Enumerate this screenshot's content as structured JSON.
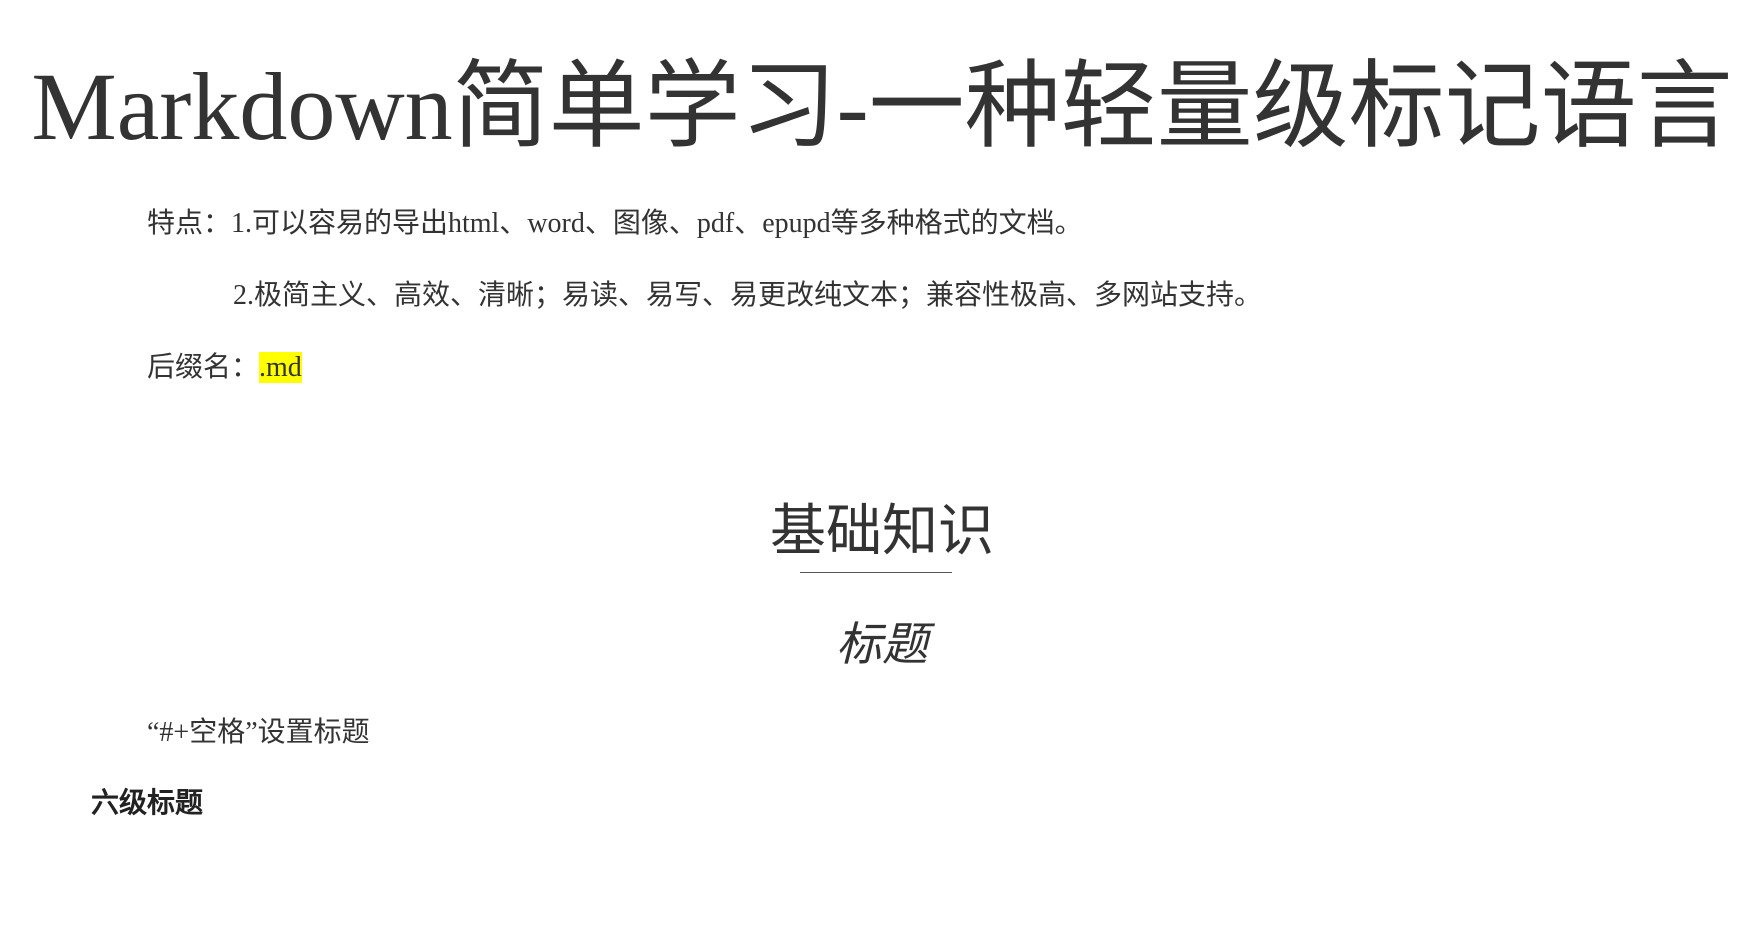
{
  "document": {
    "title": "Markdown简单学习-一种轻量级标记语言",
    "features_line1": "特点：1.可以容易的导出html、word、图像、pdf、epupd等多种格式的文档。",
    "features_line2": "2.极简主义、高效、清晰；易读、易写、易更改纯文本；兼容性极高、多网站支持。",
    "suffix_label": "后缀名：",
    "suffix_value": ".md",
    "section_heading": "基础知识",
    "subsection_heading": "标题",
    "heading_instruction": "“#+空格”设置标题",
    "level6_heading": "六级标题"
  },
  "colors": {
    "text": "#333333",
    "highlight": "#ffff00"
  }
}
